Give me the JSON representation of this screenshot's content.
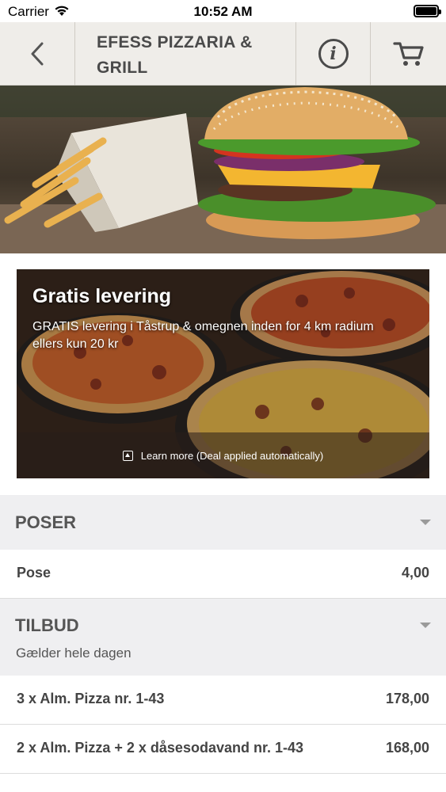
{
  "status_bar": {
    "carrier": "Carrier",
    "time": "10:52 AM"
  },
  "nav": {
    "title": "EFESS PIZZARIA & GRILL",
    "back_icon": "chevron-left-icon",
    "info_icon": "info-icon",
    "cart_icon": "cart-icon"
  },
  "deal": {
    "title": "Gratis levering",
    "description": "GRATIS levering i Tåstrup & omegnen inden for 4 km radium ellers kun 20 kr",
    "footer_label": "Learn more (Deal applied automatically)"
  },
  "menu": {
    "sections": [
      {
        "title": "POSER",
        "subtitle": "",
        "items": [
          {
            "name": "Pose",
            "price": "4,00"
          }
        ]
      },
      {
        "title": "TILBUD",
        "subtitle": "Gælder hele dagen",
        "items": [
          {
            "name": "3 x Alm. Pizza nr. 1-43",
            "price": "178,00"
          },
          {
            "name": "2 x Alm. Pizza + 2 x dåsesodavand nr. 1-43",
            "price": "168,00"
          }
        ]
      }
    ]
  },
  "colors": {
    "section_bg": "#efeff1",
    "nav_bg": "#eeece8",
    "text_dark": "#444444"
  }
}
